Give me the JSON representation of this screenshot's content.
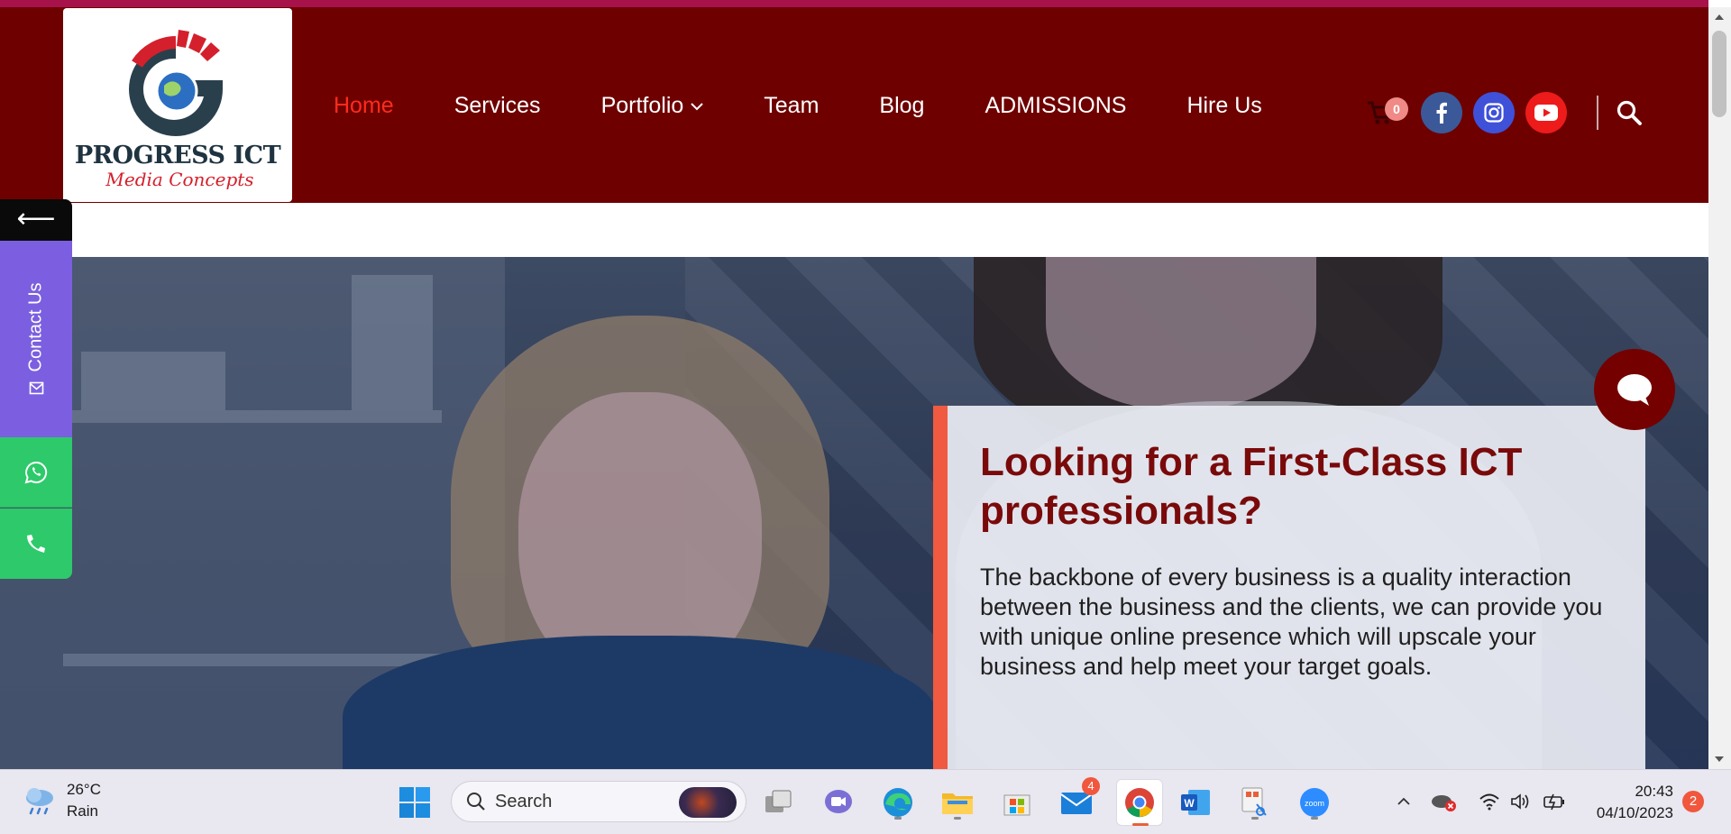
{
  "site": {
    "logo": {
      "name": "PROGRESS ICT",
      "tagline": "Media Concepts"
    },
    "nav": [
      {
        "label": "Home",
        "active": true
      },
      {
        "label": "Services"
      },
      {
        "label": "Portfolio",
        "has_dropdown": true
      },
      {
        "label": "Team"
      },
      {
        "label": "Blog"
      },
      {
        "label": "ADMISSIONS"
      },
      {
        "label": "Hire Us"
      }
    ],
    "cart": {
      "icon": "cart-icon",
      "count": "0"
    },
    "social": [
      {
        "icon": "facebook-icon",
        "color": "#3b5998"
      },
      {
        "icon": "instagram-icon",
        "color": "#3f51d8"
      },
      {
        "icon": "youtube-icon",
        "color": "#ee1b1b"
      }
    ],
    "colors": {
      "header_bg": "#6e0000",
      "accent": "#ff2b1c",
      "card_title": "#7a0a0a"
    }
  },
  "side": {
    "arrow": "⟵",
    "contact_label": "Contact Us"
  },
  "hero": {
    "title": "Looking for a First-Class ICT professionals?",
    "body": "The backbone of every business is a quality interaction between the business and the clients, we can provide you with unique online presence which will upscale your business and help meet your target goals."
  },
  "taskbar": {
    "weather": {
      "temp": "26°C",
      "condition": "Rain"
    },
    "search_placeholder": "Search",
    "mail_badge": "4",
    "clock": {
      "time": "20:43",
      "date": "04/10/2023"
    },
    "notifications": "2"
  }
}
